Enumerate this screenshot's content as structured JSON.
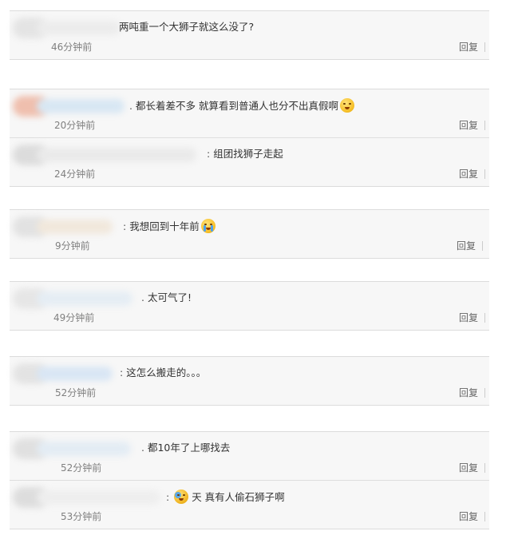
{
  "reply_label": "回复",
  "threads": [
    {
      "comments": [
        {
          "text": "两吨重一个大狮子就这么没了?",
          "time": "46分钟前",
          "emoji": null
        }
      ]
    },
    {
      "comments": [
        {
          "text": "都长着差不多 就算看到普通人也分不出真假啊",
          "time": "20分钟前",
          "emoji": "sweat-face"
        },
        {
          "text": "组团找狮子走起",
          "time": "24分钟前",
          "emoji": null
        }
      ]
    },
    {
      "comments": [
        {
          "text": "我想回到十年前",
          "time": "9分钟前",
          "emoji": "crying-face"
        }
      ]
    },
    {
      "comments": [
        {
          "text": "太可气了!",
          "time": "49分钟前",
          "emoji": null
        }
      ]
    },
    {
      "comments": [
        {
          "text": "这怎么搬走的。。。",
          "time": "52分钟前",
          "emoji": null
        }
      ]
    },
    {
      "comments": [
        {
          "text": "都10年了上哪找去",
          "time": "52分钟前",
          "emoji": null
        },
        {
          "text": "天 真有人偷石狮子啊",
          "time": "53分钟前",
          "emoji": "tear-face"
        }
      ]
    }
  ]
}
